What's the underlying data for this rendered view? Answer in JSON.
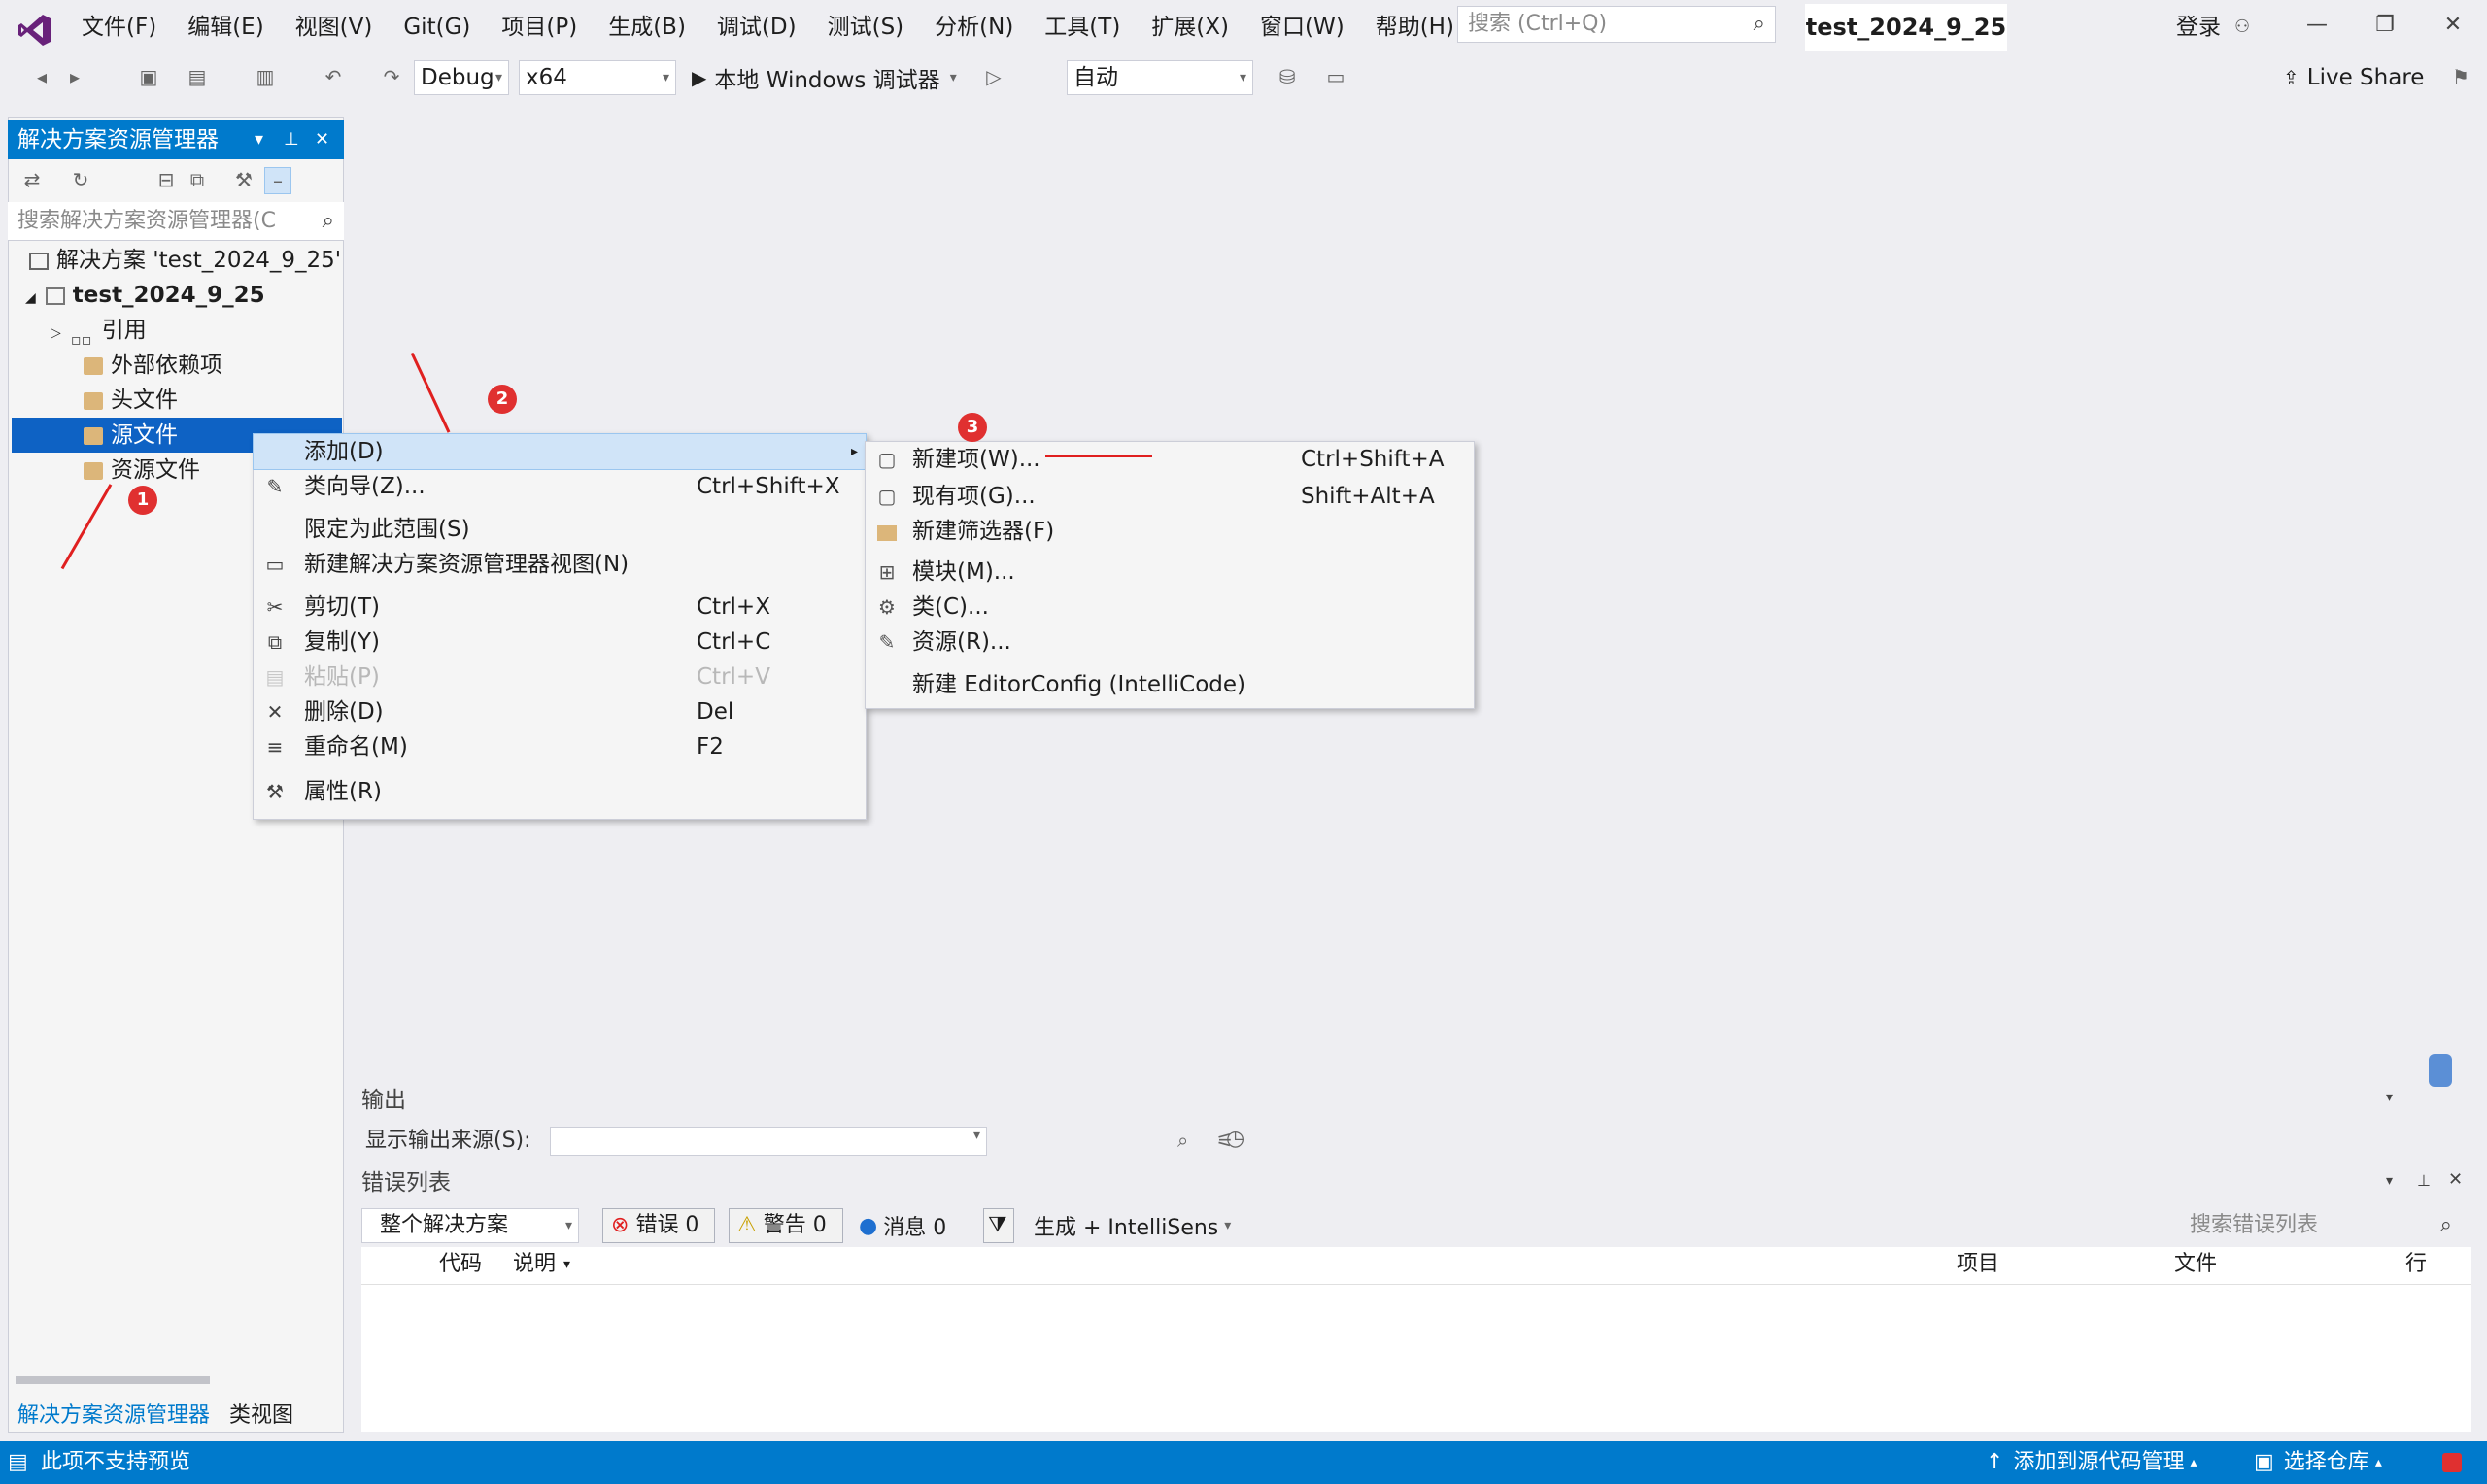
{
  "titlebar": {
    "menus": [
      "文件(F)",
      "编辑(E)",
      "视图(V)",
      "Git(G)",
      "项目(P)",
      "生成(B)",
      "调试(D)",
      "测试(S)",
      "分析(N)",
      "工具(T)",
      "扩展(X)",
      "窗口(W)",
      "帮助(H)"
    ],
    "search_placeholder": "搜索 (Ctrl+Q)",
    "solution_name": "test_2024_9_25",
    "login": "登录"
  },
  "toolbar": {
    "config": "Debug",
    "platform": "x64",
    "run_label": "本地 Windows 调试器",
    "auto": "自动",
    "live_share": "Live Share"
  },
  "solution_explorer": {
    "title": "解决方案资源管理器",
    "search_placeholder": "搜索解决方案资源管理器(C",
    "tree": {
      "solution": "解决方案 'test_2024_9_25'",
      "project": "test_2024_9_25",
      "references": "引用",
      "external_deps": "外部依赖项",
      "header_files": "头文件",
      "source_files": "源文件",
      "resource_files": "资源文件"
    },
    "bottom_tabs": [
      "解决方案资源管理器",
      "类视图"
    ]
  },
  "context_menu": {
    "items": [
      {
        "label": "添加(D)",
        "shortcut": "",
        "icon": "",
        "highlight": true,
        "submenu": true
      },
      {
        "label": "类向导(Z)...",
        "shortcut": "Ctrl+Shift+X",
        "icon": "wizard-icon"
      },
      {
        "label": "限定为此范围(S)",
        "shortcut": "",
        "icon": ""
      },
      {
        "label": "新建解决方案资源管理器视图(N)",
        "shortcut": "",
        "icon": "new-view-icon"
      },
      {
        "label": "剪切(T)",
        "shortcut": "Ctrl+X",
        "icon": "scissors-icon"
      },
      {
        "label": "复制(Y)",
        "shortcut": "Ctrl+C",
        "icon": "copy-icon"
      },
      {
        "label": "粘贴(P)",
        "shortcut": "Ctrl+V",
        "icon": "paste-icon",
        "disabled": true
      },
      {
        "label": "删除(D)",
        "shortcut": "Del",
        "icon": "delete-icon"
      },
      {
        "label": "重命名(M)",
        "shortcut": "F2",
        "icon": "rename-icon"
      },
      {
        "label": "属性(R)",
        "shortcut": "",
        "icon": "wrench-icon"
      }
    ]
  },
  "submenu": {
    "items": [
      {
        "label": "新建项(W)...",
        "shortcut": "Ctrl+Shift+A"
      },
      {
        "label": "现有项(G)...",
        "shortcut": "Shift+Alt+A"
      },
      {
        "label": "新建筛选器(F)",
        "shortcut": ""
      },
      {
        "label": "模块(M)...",
        "shortcut": ""
      },
      {
        "label": "类(C)...",
        "shortcut": ""
      },
      {
        "label": "资源(R)...",
        "shortcut": ""
      },
      {
        "label": "新建 EditorConfig (IntelliCode)",
        "shortcut": ""
      }
    ]
  },
  "output": {
    "title": "输出",
    "source_label": "显示输出来源(S):"
  },
  "error_list": {
    "title": "错误列表",
    "scope": "整个解决方案",
    "errors": "错误 0",
    "warnings": "警告 0",
    "messages": "消息 0",
    "build_filter": "生成 + IntelliSens",
    "search_placeholder": "搜索错误列表",
    "columns": [
      "代码",
      "说明",
      "项目",
      "文件",
      "行"
    ]
  },
  "status_bar": {
    "left": "此项不支持预览",
    "add_to_source": "添加到源代码管理",
    "select_repo": "选择仓库"
  },
  "annotations": {
    "badges": [
      "1",
      "2",
      "3"
    ]
  },
  "colors": {
    "accent": "#007acc",
    "selection": "#0e62c4",
    "annotation": "#e03030"
  }
}
